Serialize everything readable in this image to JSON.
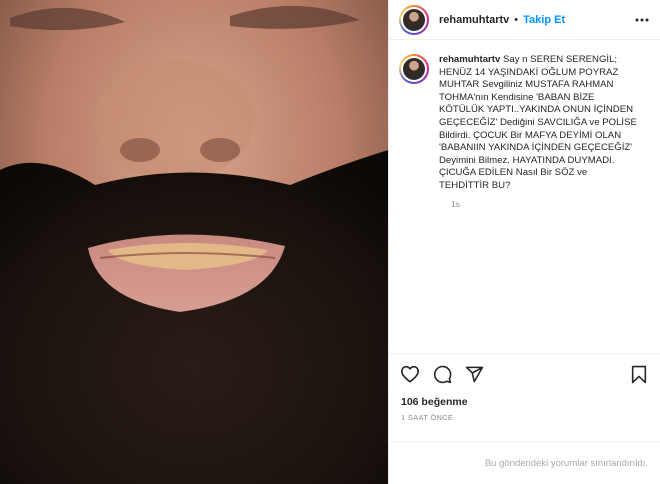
{
  "post": {
    "username": "rehamuhtartv",
    "separator": "•",
    "follow_label": "Takip Et",
    "caption": "Say n SEREN SERENGİL; HENÜZ 14 YAŞINDAKİ OĞLUM POYRAZ MUHTAR Sevgiliniz MUSTAFA RAHMAN TOHMA'nın Kendisine 'BABAN BİZE KÖTÜLÜK YAPTI..YAKINDA ONUN İÇİNDEN GEÇECEĞİZ' Dediğini SAVCILIĞA ve POLİSE Bildirdi. ÇOCUK Bir MAFYA DEYİMİ OLAN 'BABANIIN YAKINDA İÇİNDEN GEÇECEĞİZ' Deyimini Bilmez. HAYATINDA DUYMADI. ÇICUĞA EDİLEN Nasıl Bir SÖZ ve TEHDİTTİR BU?",
    "comment_time": "1s",
    "likes": "106 beğenme",
    "posted_ago": "1 SAAT ÖNCE",
    "comments_restricted": "Bu gönderideki yorumlar sınırlandırıldı."
  },
  "icons": {
    "more": "more-horizontal-icon",
    "like": "heart-icon",
    "comment": "comment-icon",
    "share": "send-icon",
    "save": "bookmark-icon"
  },
  "colors": {
    "accent": "#0095f6",
    "text": "#262626",
    "muted": "#8e8e8e",
    "border": "#efefef"
  }
}
